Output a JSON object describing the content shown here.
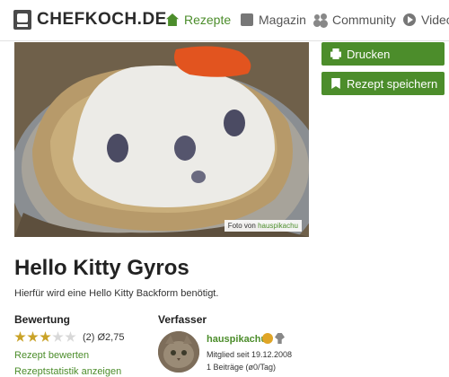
{
  "header": {
    "logo_text": "CHEFKOCH.DE",
    "nav": [
      {
        "label": "Rezepte",
        "icon": "home-icon",
        "active": true
      },
      {
        "label": "Magazin",
        "icon": "magazine-icon",
        "active": false
      },
      {
        "label": "Community",
        "icon": "community-icon",
        "active": false
      },
      {
        "label": "Video",
        "icon": "video-icon",
        "active": false
      }
    ]
  },
  "photo": {
    "credit_prefix": "Foto von",
    "credit_user": "hauspikachu"
  },
  "actions": {
    "print_label": "Drucken",
    "save_label": "Rezept speichern"
  },
  "recipe": {
    "title": "Hello Kitty Gyros",
    "subtitle": "Hierfür wird eine Hello Kitty Backform benötigt."
  },
  "rating": {
    "heading": "Bewertung",
    "stars_filled": 3,
    "stars_total": 5,
    "count_text": "(2) Ø2,75",
    "rate_link": "Rezept bewerten",
    "stats_link": "Rezeptstatistik anzeigen"
  },
  "author": {
    "heading": "Verfasser",
    "name": "hauspikachu",
    "member_since": "Mitglied seit 19.12.2008",
    "posts": "1 Beiträge (ø0/Tag)"
  },
  "colors": {
    "accent": "#4c8d2b",
    "star": "#c9a227"
  }
}
